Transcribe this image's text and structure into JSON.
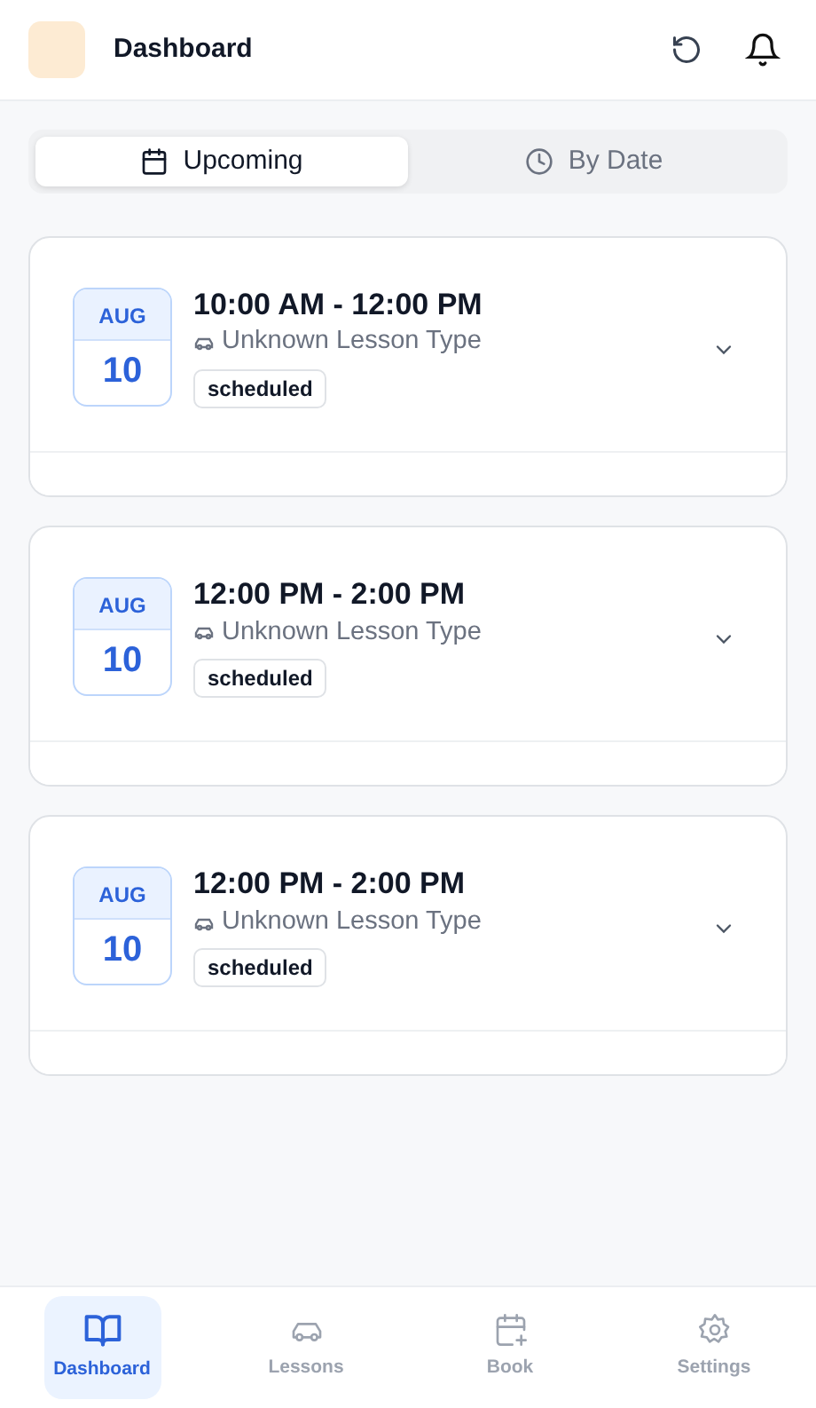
{
  "header": {
    "title": "Dashboard"
  },
  "tabs": [
    {
      "label": "Upcoming",
      "selected": true
    },
    {
      "label": "By Date",
      "selected": false
    }
  ],
  "lessons": [
    {
      "month": "AUG",
      "day": "10",
      "time": "10:00 AM - 12:00 PM",
      "type": "Unknown Lesson Type",
      "status": "scheduled"
    },
    {
      "month": "AUG",
      "day": "10",
      "time": "12:00 PM - 2:00 PM",
      "type": "Unknown Lesson Type",
      "status": "scheduled"
    },
    {
      "month": "AUG",
      "day": "10",
      "time": "12:00 PM - 2:00 PM",
      "type": "Unknown Lesson Type",
      "status": "scheduled"
    }
  ],
  "bottom_nav": [
    {
      "label": "Dashboard",
      "selected": true
    },
    {
      "label": "Lessons",
      "selected": false
    },
    {
      "label": "Book",
      "selected": false
    },
    {
      "label": "Settings",
      "selected": false
    }
  ]
}
